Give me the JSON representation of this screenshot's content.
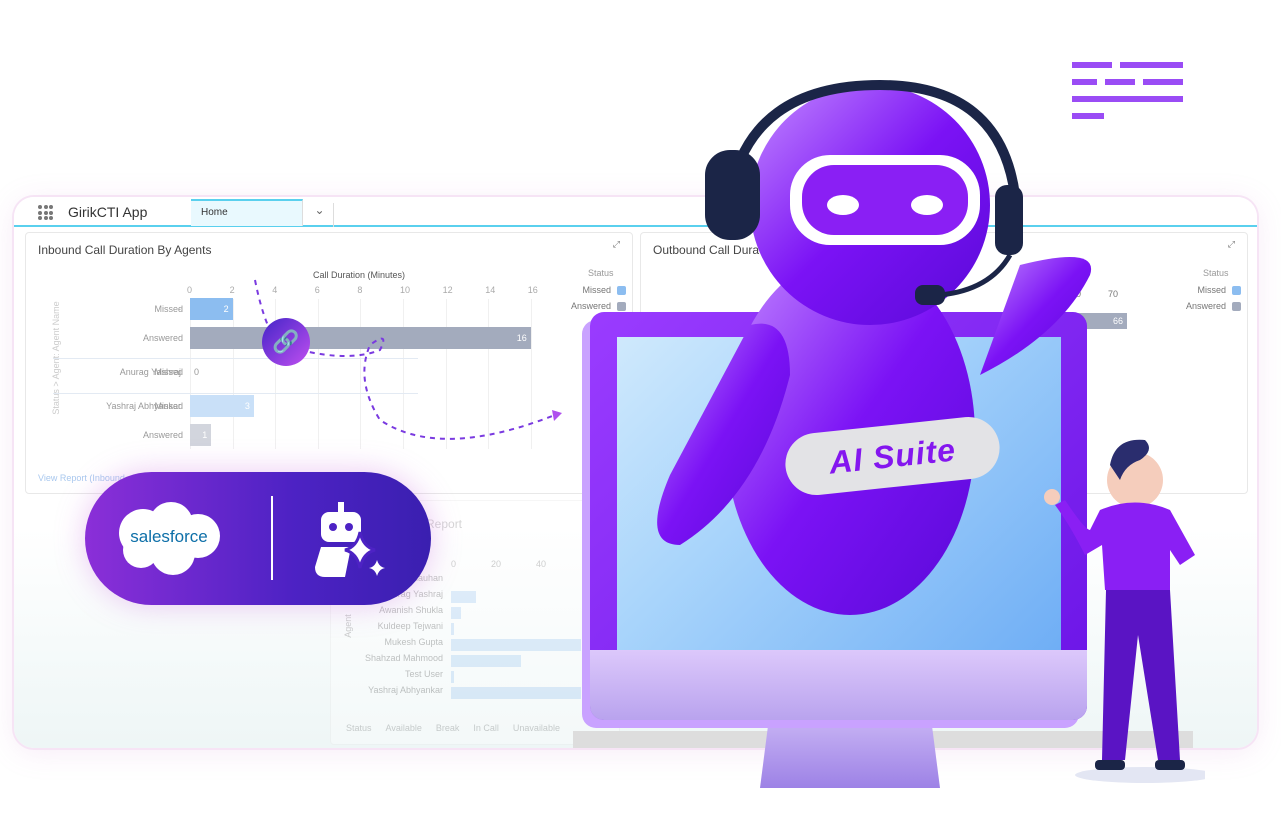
{
  "app": {
    "name": "GirikCTI App",
    "tab": "Home"
  },
  "inbound": {
    "title": "Inbound Call Duration By Agents",
    "x_axis_label": "Call Duration (Minutes)",
    "y_axis_label": "Status > Agent: Agent Name",
    "legend_title": "Status",
    "legend": [
      {
        "label": "Missed",
        "color": "#8cbdf0"
      },
      {
        "label": "Answered",
        "color": "#a3abbd"
      }
    ],
    "view_report": "View Report (Inbound"
  },
  "chart_data": [
    {
      "type": "bar",
      "orientation": "horizontal",
      "title": "Inbound Call Duration By Agents",
      "xlabel": "Call Duration (Minutes)",
      "ylabel": "Status > Agent: Agent Name",
      "xlim": [
        0,
        16
      ],
      "ticks": [
        0,
        2,
        4,
        6,
        8,
        10,
        12,
        14,
        16
      ],
      "grid": true,
      "legend": "right",
      "rows": [
        {
          "agent": "-",
          "status": "Missed",
          "value": 2
        },
        {
          "agent": "",
          "status": "Answered",
          "value": 16
        },
        {
          "agent": "Anurag Yashraj",
          "status": "Missed",
          "value": 0
        },
        {
          "agent": "Yashraj Abhyankar",
          "status": "Missed",
          "value": 3
        },
        {
          "agent": "",
          "status": "Answered",
          "value": 1
        }
      ]
    },
    {
      "type": "bar",
      "orientation": "horizontal",
      "title": "Outbound Call Dura",
      "ticks_visible": [
        60,
        70
      ],
      "legend": "right",
      "rows": [
        {
          "agent": "-",
          "status": "Answered",
          "value": 66
        }
      ]
    }
  ],
  "outbound": {
    "title": "Outbound Call Dura",
    "legend_title": "Status",
    "legend": [
      {
        "label": "Missed",
        "color": "#8cbdf0"
      },
      {
        "label": "Answered",
        "color": "#a3abbd"
      }
    ]
  },
  "report": {
    "title": "Report",
    "ylabel": "Agent",
    "ticks": [
      "0",
      "20",
      "40"
    ],
    "agents": [
      "Chauhan",
      "Anurag Yashraj",
      "Awanish Shukla",
      "Kuldeep Tejwani",
      "Mukesh Gupta",
      "Shahzad Mahmood",
      "Test User",
      "Yashraj Abhyankar"
    ],
    "legend": [
      "Status",
      "Available",
      "Break",
      "In Call",
      "Unavailable"
    ]
  },
  "badge": {
    "brand": "salesforce",
    "ai_label": "AI Suite"
  },
  "colors": {
    "purple": "#8416ef",
    "cyan": "#5ad0ee",
    "missed": "#8cbdf0",
    "answered": "#a3abbd"
  }
}
